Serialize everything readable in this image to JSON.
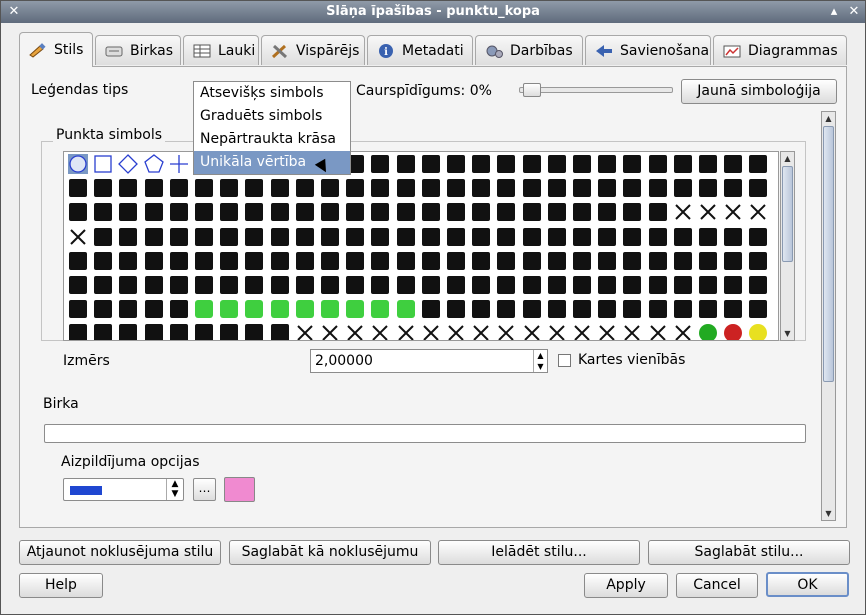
{
  "window": {
    "title": "Slāņa īpašības - punktu_kopa"
  },
  "tabs": [
    {
      "label": "Stils",
      "icon": "brush-icon",
      "active": true
    },
    {
      "label": "Birkas",
      "icon": "label-icon"
    },
    {
      "label": "Lauki",
      "icon": "table-icon"
    },
    {
      "label": "Vispārējs",
      "icon": "tools-icon"
    },
    {
      "label": "Metadati",
      "icon": "info-icon"
    },
    {
      "label": "Darbības",
      "icon": "gears-icon"
    },
    {
      "label": "Savienošana",
      "icon": "join-icon"
    },
    {
      "label": "Diagrammas",
      "icon": "chart-icon"
    }
  ],
  "style": {
    "legend_label": "Leģendas tips",
    "transparency_label": "Caurspīdīgums: 0%",
    "transparency_value": 0,
    "new_symbology_button": "Jaunā simboloģija",
    "dropdown_options": [
      "Atsevišķs simbols",
      "Graduēts simbols",
      "Nepārtraukta krāsa",
      "Unikāla vērtība"
    ],
    "dropdown_highlighted": "Unikāla vērtība",
    "point_symbol_label": "Punkta simbols",
    "size_label": "Izmērs",
    "size_value": "2,00000",
    "map_units_label": "Kartes vienībās",
    "map_units_checked": false,
    "label_section": "Birka",
    "label_value": "",
    "fill_options_label": "Aizpildījuma opcijas",
    "fill_color": "#1f47d1",
    "outline_color": "#f08ad0",
    "dots_button": "…"
  },
  "bottom_buttons": {
    "restore_default": "Atjaunot noklusējuma stilu",
    "save_default": "Saglabāt kā noklusējumu",
    "load_style": "Ielādēt stilu...",
    "save_style": "Saglabāt stilu...",
    "help": "Help",
    "apply": "Apply",
    "cancel": "Cancel",
    "ok": "OK"
  }
}
